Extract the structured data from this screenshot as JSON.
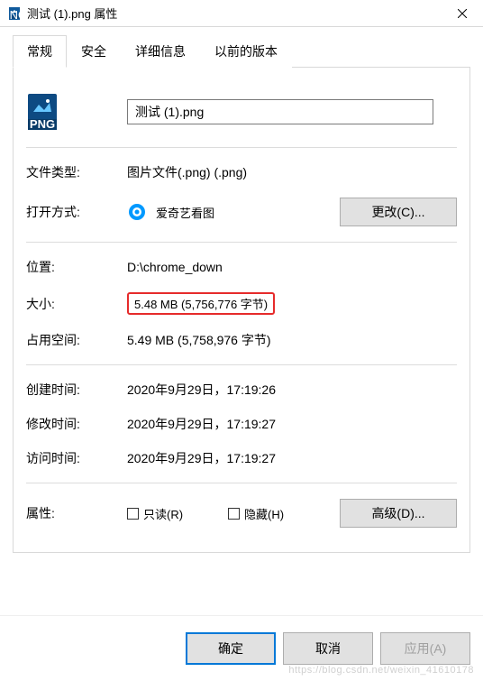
{
  "titlebar": {
    "title": "测试 (1).png 属性"
  },
  "tabs": {
    "general": "常规",
    "security": "安全",
    "details": "详细信息",
    "previous": "以前的版本"
  },
  "filename": {
    "value": "测试 (1).png"
  },
  "labels": {
    "filetype": "文件类型:",
    "openwith": "打开方式:",
    "location": "位置:",
    "size": "大小:",
    "sizeondisk": "占用空间:",
    "created": "创建时间:",
    "modified": "修改时间:",
    "accessed": "访问时间:",
    "attributes": "属性:"
  },
  "values": {
    "filetype": "图片文件(.png) (.png)",
    "openwith_app": "爱奇艺看图",
    "location": "D:\\chrome_down",
    "size": "5.48 MB (5,756,776 字节)",
    "sizeondisk": "5.49 MB (5,758,976 字节)",
    "created": "2020年9月29日，17:19:26",
    "modified": "2020年9月29日，17:19:27",
    "accessed": "2020年9月29日，17:19:27"
  },
  "buttons": {
    "change": "更改(C)...",
    "advanced": "高级(D)...",
    "ok": "确定",
    "cancel": "取消",
    "apply": "应用(A)"
  },
  "checkboxes": {
    "readonly": "只读(R)",
    "hidden": "隐藏(H)"
  },
  "watermark": "https://blog.csdn.net/weixin_41610178"
}
